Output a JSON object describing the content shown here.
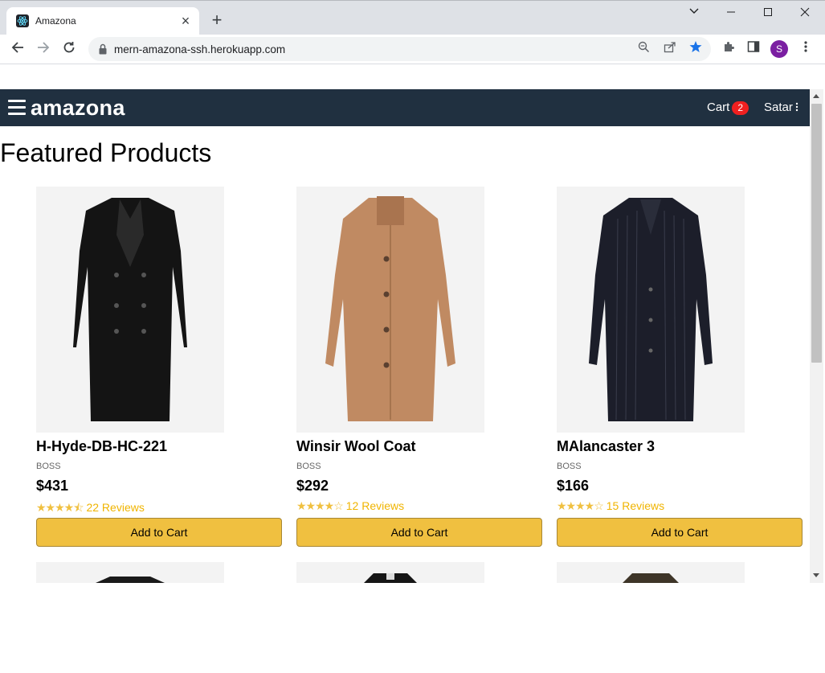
{
  "browser": {
    "tab_title": "Amazona",
    "url": "mern-amazona-ssh.herokuapp.com",
    "profile_initial": "S"
  },
  "header": {
    "brand": "amazona",
    "cart_label": "Cart",
    "cart_count": "2",
    "user_name": "Satar"
  },
  "page_title": "Featured Products",
  "products": [
    {
      "name": "H-Hyde-DB-HC-221",
      "brand": "BOSS",
      "price": "$431",
      "stars": "★★★★⯪",
      "reviews": "22 Reviews",
      "button": "Add to Cart",
      "coat_color": "#141414"
    },
    {
      "name": "Winsir Wool Coat",
      "brand": "BOSS",
      "price": "$292",
      "stars": "★★★★☆",
      "reviews": "12 Reviews",
      "button": "Add to Cart",
      "coat_color": "#c08a62"
    },
    {
      "name": "MAlancaster 3",
      "brand": "BOSS",
      "price": "$166",
      "stars": "★★★★☆",
      "reviews": "15 Reviews",
      "button": "Add to Cart",
      "coat_color": "#1c1e2a"
    }
  ],
  "colors": {
    "header_bg": "#203040",
    "button_bg": "#f0c040",
    "badge_bg": "#f02020",
    "star": "#f0c040"
  }
}
